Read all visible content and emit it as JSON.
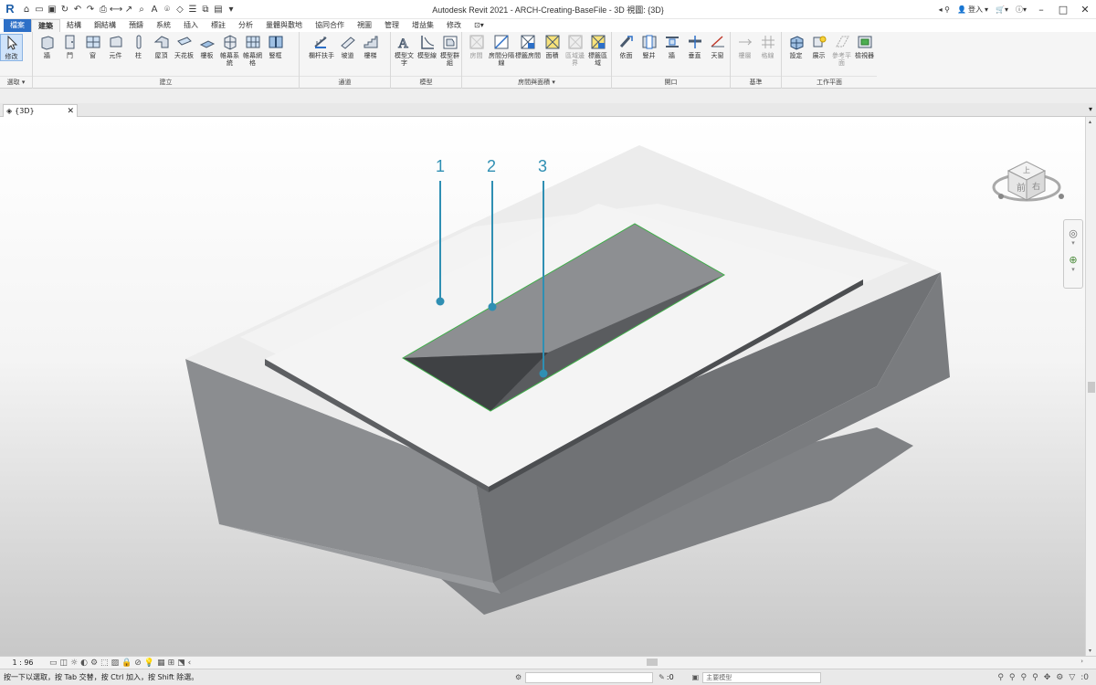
{
  "app": {
    "title": "Autodesk Revit 2021 - ARCH-Creating-BaseFile - 3D 視圖: {3D}",
    "logo": "R",
    "signin": "登入"
  },
  "tabs": [
    "檔案",
    "建築",
    "結構",
    "鋼結構",
    "預鑄",
    "系統",
    "插入",
    "標註",
    "分析",
    "量體與敷地",
    "協同合作",
    "視圖",
    "管理",
    "增益集",
    "修改"
  ],
  "ribbon": {
    "select_panel": {
      "button": "修改",
      "title": "選取 ▾"
    },
    "build": {
      "title": "建立",
      "buttons": [
        "牆",
        "門",
        "窗",
        "元件",
        "柱",
        "屋頂",
        "天花板",
        "樓板",
        "帷幕系統",
        "帷幕網格",
        "豎框"
      ]
    },
    "circulation": {
      "title": "通道",
      "buttons": [
        "欄杆扶手",
        "坡道",
        "樓梯"
      ]
    },
    "model": {
      "title": "模型",
      "buttons": [
        "模型文字",
        "模型線",
        "模型群組"
      ]
    },
    "room_area": {
      "title": "房間與面積 ▾",
      "buttons": [
        "房間",
        "房間分隔線",
        "標籤房間",
        "面積",
        "區域邊界",
        "標籤區域"
      ]
    },
    "opening": {
      "title": "開口",
      "buttons": [
        "依面",
        "豎井",
        "牆",
        "垂直",
        "天窗"
      ]
    },
    "datum": {
      "title": "基準",
      "buttons": [
        "樓層",
        "格線"
      ]
    },
    "work_plane": {
      "title": "工作平面",
      "buttons": [
        "設定",
        "展示",
        "參考平面",
        "檢視器"
      ]
    }
  },
  "document": {
    "tab_label": "{3D}"
  },
  "callouts": [
    "1",
    "2",
    "3"
  ],
  "view_control": {
    "scale": "1 : 96"
  },
  "status": {
    "message": "按一下以選取，按 Tab 交替，按 Ctrl 加入，按 Shift 除選。",
    "workset": ":0",
    "model_label": "主要模型",
    "filter_count": ":0"
  },
  "colors": {
    "accent": "#2c6fc7",
    "callout": "#2f8fb3",
    "opening_edge": "#3fae49"
  }
}
